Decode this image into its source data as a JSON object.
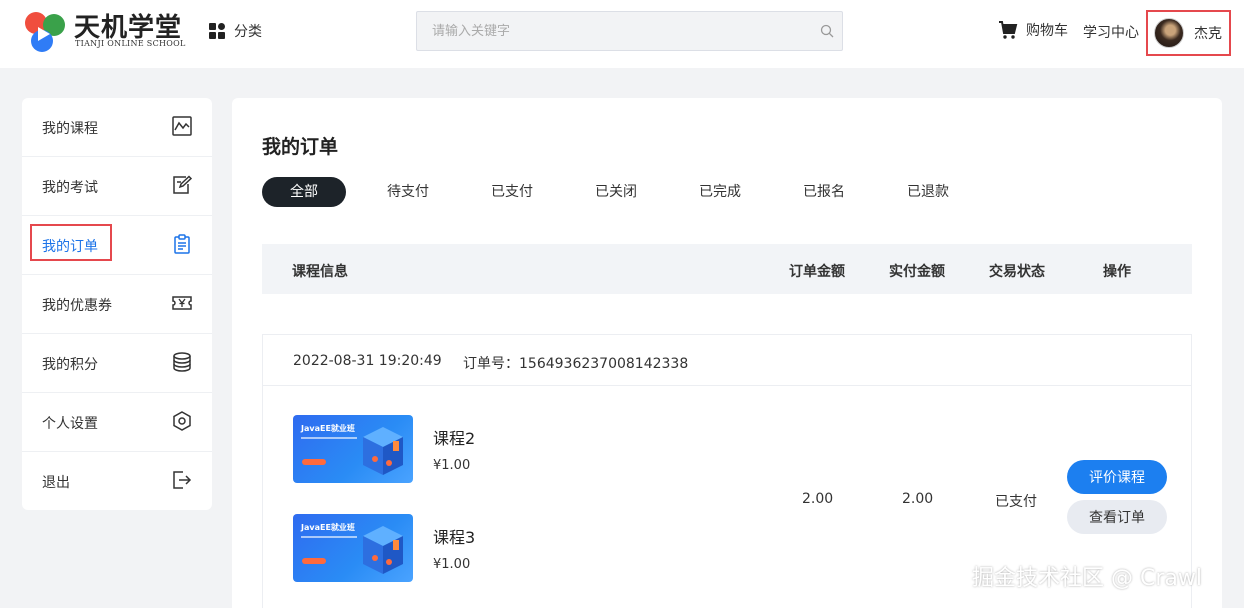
{
  "header": {
    "logo_title": "天机学堂",
    "logo_subtitle": "TIANJI ONLINE SCHOOL",
    "category_label": "分类",
    "search_placeholder": "请输入关键字",
    "cart_label": "购物车",
    "study_center_label": "学习中心",
    "user_name": "杰克"
  },
  "sidebar": {
    "items": [
      {
        "label": "我的课程",
        "icon": "chart-icon"
      },
      {
        "label": "我的考试",
        "icon": "edit-icon"
      },
      {
        "label": "我的订单",
        "icon": "clipboard-icon",
        "active": true
      },
      {
        "label": "我的优惠券",
        "icon": "coupon-icon"
      },
      {
        "label": "我的积分",
        "icon": "coins-icon"
      },
      {
        "label": "个人设置",
        "icon": "settings-hexagon-icon"
      },
      {
        "label": "退出",
        "icon": "logout-icon"
      }
    ]
  },
  "main": {
    "title": "我的订单",
    "tabs": [
      "全部",
      "待支付",
      "已支付",
      "已关闭",
      "已完成",
      "已报名",
      "已退款"
    ],
    "active_tab": "全部",
    "columns": [
      "课程信息",
      "订单金额",
      "实付金额",
      "交易状态",
      "操作"
    ],
    "order": {
      "date": "2022-08-31 19:20:49",
      "order_no_label": "订单号：",
      "order_no": "1564936237008142338",
      "courses": [
        {
          "name": "课程2",
          "price": "¥1.00",
          "thumb_title": "JavaEE就业班"
        },
        {
          "name": "课程3",
          "price": "¥1.00",
          "thumb_title": "JavaEE就业班"
        }
      ],
      "order_amount": "2.00",
      "paid_amount": "2.00",
      "status": "已支付",
      "actions": {
        "review": "评价课程",
        "view": "查看订单"
      }
    }
  },
  "watermark": "掘金技术社区 @ Crawl",
  "colors": {
    "accent": "#1c7ff0",
    "highlight_box": "#e5484d",
    "active_tab_bg": "#1d2329"
  }
}
